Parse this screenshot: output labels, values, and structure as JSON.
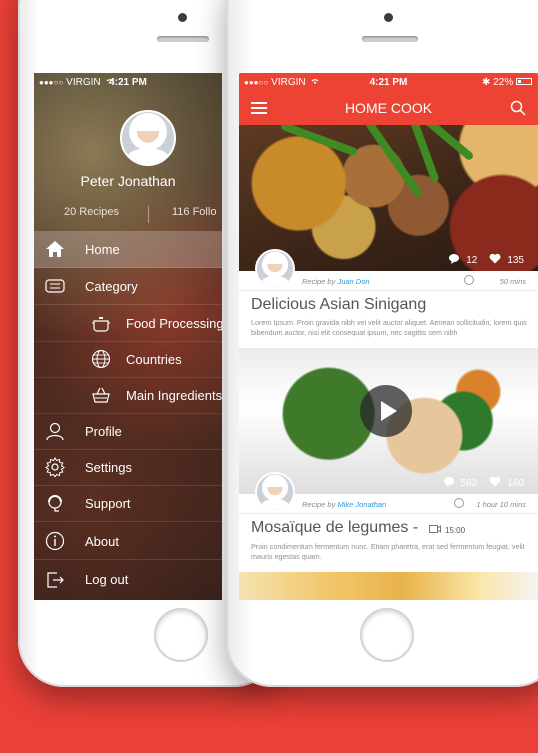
{
  "left_phone": {
    "status": {
      "carrier": "VIRGIN",
      "time": "4:21 PM"
    },
    "profile": {
      "name": "Peter Jonathan",
      "recipes": "20 Recipes",
      "followers": "116 Follo"
    },
    "menu": [
      {
        "label": "Home",
        "icon": "home-icon",
        "active": true
      },
      {
        "label": "Category",
        "icon": "category-icon"
      },
      {
        "label": "Food Processing",
        "icon": "pot-icon",
        "sub": true
      },
      {
        "label": "Countries",
        "icon": "globe-icon",
        "sub": true
      },
      {
        "label": "Main Ingredients",
        "icon": "basket-icon",
        "sub": true
      },
      {
        "label": "Profile",
        "icon": "user-icon"
      },
      {
        "label": "Settings",
        "icon": "gear-icon"
      },
      {
        "label": "Support",
        "icon": "headset-icon"
      },
      {
        "label": "About",
        "icon": "info-icon"
      },
      {
        "label": "Log out",
        "icon": "logout-icon"
      }
    ]
  },
  "right_phone": {
    "status": {
      "carrier": "VIRGIN",
      "time": "4:21 PM",
      "battery": "22%"
    },
    "header": {
      "title": "HOME COOK"
    },
    "cards": [
      {
        "comments": "12",
        "likes": "135",
        "recipe_by_prefix": "Recipe by",
        "author": "Juan Don",
        "time": "50 mins",
        "title": "Delicious Asian Sinigang",
        "description": "Lorem Ipsum. Proin gravida nibh vel velit auctor aliquet. Aenean sollicitudin, lorem quis bibendum auctor, nisi elit consequat ipsum, nec sagittis sem nibh"
      },
      {
        "comments": "562",
        "likes": "160",
        "recipe_by_prefix": "Recipe by",
        "author": "Mike Jonathan",
        "time": "1 hour 10 mins",
        "title": "Mosaïque de legumes -",
        "video_duration": "15:00",
        "description": "Proin condimentum fermentum nunc. Etiam pharetra, erat sed fermentum feugiat, velit mauris egestas quam."
      }
    ]
  },
  "colors": {
    "brand_red": "#ec4335",
    "background": "#ea4038",
    "link_blue": "#2a9de0"
  }
}
